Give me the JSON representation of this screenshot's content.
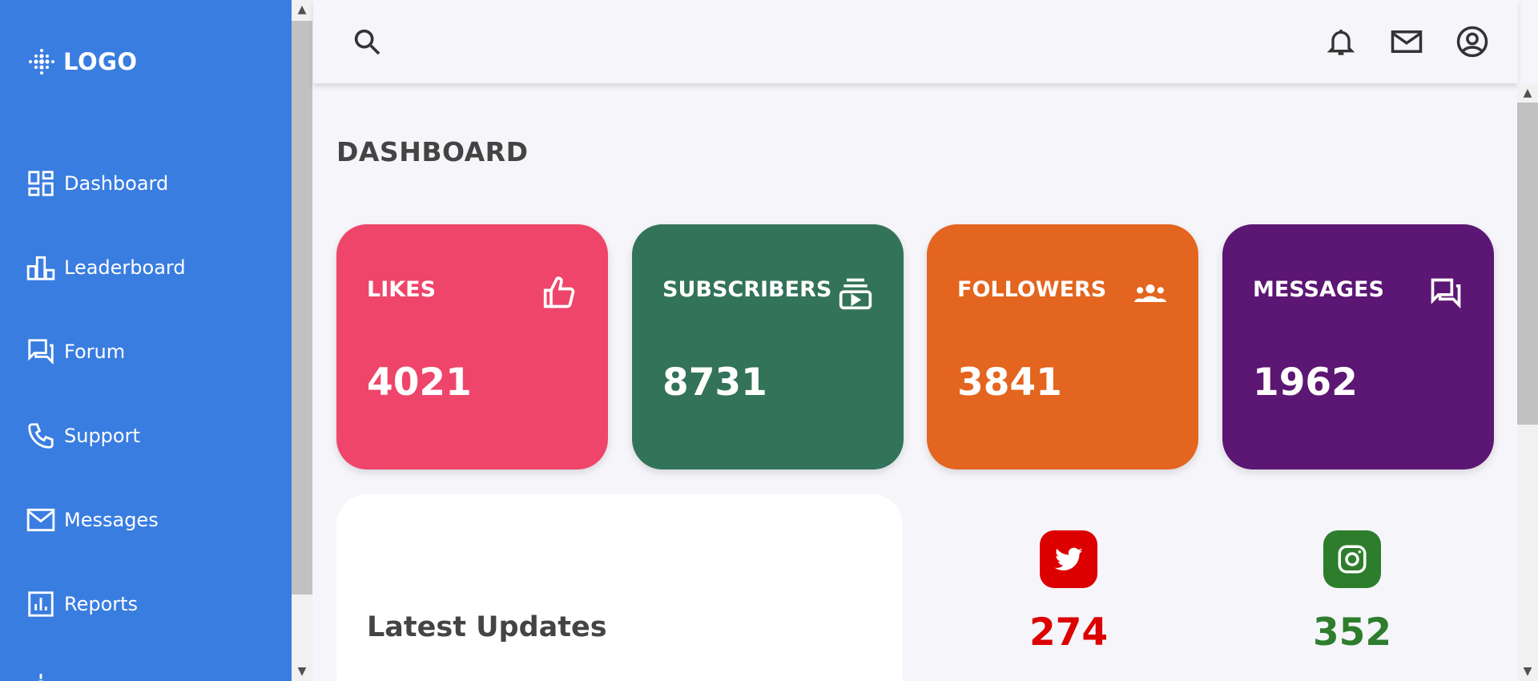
{
  "colors": {
    "sidebar": "#3a7de0",
    "likes": "#ef456a",
    "subscribers": "#33735a",
    "followers": "#e3651f",
    "messages": "#5c1673",
    "twitter": "#dc0000",
    "instagram": "#2d7d2d"
  },
  "logo": {
    "text": "LOGO",
    "icon": "dots-logo-icon"
  },
  "sidebar": {
    "items": [
      {
        "label": "Dashboard",
        "icon": "dashboard-icon"
      },
      {
        "label": "Leaderboard",
        "icon": "leaderboard-icon"
      },
      {
        "label": "Forum",
        "icon": "forum-icon"
      },
      {
        "label": "Support",
        "icon": "phone-icon"
      },
      {
        "label": "Messages",
        "icon": "mail-icon"
      },
      {
        "label": "Reports",
        "icon": "reports-icon"
      }
    ]
  },
  "header": {
    "icons": [
      "search-icon",
      "bell-icon",
      "mail-icon",
      "account-icon"
    ]
  },
  "main": {
    "title": "DASHBOARD",
    "cards": [
      {
        "title": "LIKES",
        "value": "4021",
        "icon": "thumbs-up-icon"
      },
      {
        "title": "SUBSCRIBERS",
        "value": "8731",
        "icon": "subscriptions-icon"
      },
      {
        "title": "FOLLOWERS",
        "value": "3841",
        "icon": "group-icon"
      },
      {
        "title": "MESSAGES",
        "value": "1962",
        "icon": "chat-icon"
      }
    ],
    "updates_title": "Latest Updates",
    "social": [
      {
        "name": "twitter",
        "count": "274",
        "icon": "twitter-icon"
      },
      {
        "name": "instagram",
        "count": "352",
        "icon": "instagram-icon"
      }
    ]
  }
}
